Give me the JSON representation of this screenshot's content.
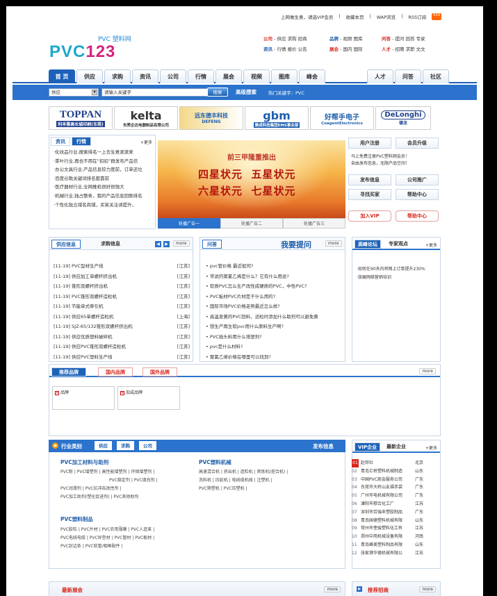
{
  "toplinks": [
    "上网做生意，请选VIP会员",
    "收藏本页",
    "WAP浏览",
    "RSS订阅"
  ],
  "logo": {
    "sub": "PVC 塑料网",
    "main1": "PVC",
    "main2": "123"
  },
  "chan1": {
    "r1": [
      "公司",
      "供应",
      "求购",
      "招商"
    ],
    "r2": [
      "资讯",
      "行情",
      "报价",
      "公告"
    ]
  },
  "chan2": {
    "r1": [
      "品牌",
      "视频",
      "图库"
    ],
    "r2": [
      "展会",
      "国内",
      "国际"
    ]
  },
  "chan3": {
    "r1": [
      "问答",
      "提问",
      "回答",
      "专家"
    ],
    "r2": [
      "人才",
      "招聘",
      "求职",
      "文文"
    ]
  },
  "tabs": [
    "首 页",
    "供应",
    "求购",
    "资讯",
    "公司",
    "行情",
    "展会",
    "视频",
    "图库",
    "峰会",
    "人才",
    "问答",
    "社区"
  ],
  "search": {
    "select": "供应",
    "input": "请输入关键字",
    "btn": "搜索",
    "adv": "高级搜索",
    "hot": "热门关键字：PVC"
  },
  "brands": [
    "TOPPAN",
    "kelta",
    "远东德丰科技",
    "gbm",
    "好帮手电子",
    "DeLonghi"
  ],
  "brand_subs": [
    "利丰雅高长城印刷(东莞)",
    "东莞企达电器制品有限公司",
    "DEFENG",
    "雅成科技集团EMS事业部",
    "CoagentElectronics",
    "德龙"
  ],
  "news_tabs": [
    "资讯",
    "行情"
  ],
  "more": "更多",
  "news": [
    "·化纹品行业,搜索排名一上去生意滚滚来",
    "·茶叶行业,再也不用在“扣扣”群发布产品信",
    "·办公文具行业,产品信息较力度前，订单还垃",
    "·百度谷歌关键词排名都靠前",
    "·医疗器材行业,全网推机很好很强大",
    "·机械行业,独占整条，我的产品信息回歌排名",
    "·个性化独立域名商铺，买家关注诱提升。"
  ],
  "banner": {
    "title": "前三甲隆重推出",
    "l1": [
      "四星状元",
      "五星状元"
    ],
    "l2": [
      "六星状元",
      "七星状元"
    ],
    "tabs": [
      "轮播广告一",
      "轮播广告二",
      "轮播广告三"
    ]
  },
  "right_btns": [
    "用户注册",
    "会员升级",
    "发布信息",
    "公司推广",
    "寻找买家",
    "帮助中心",
    "加入VIP",
    "帮助中心"
  ],
  "right_notes": [
    "马上免费注册PVC塑料网会员！",
    "自由发布信息，无限产品空间！"
  ],
  "supply_tabs": [
    "供应信息",
    "求购信息"
  ],
  "supply": [
    [
      "[11-19]",
      "PVC型材生产线",
      "[江苏]"
    ],
    [
      "[11-19]",
      "供应加工单螺杆挤出机",
      "[江苏]"
    ],
    [
      "[11-19]",
      "锥形双螺杆挤出机",
      "[江苏]"
    ],
    [
      "[11-19]",
      "PVC锥形双螺杆造粒机",
      "[江苏]"
    ],
    [
      "[11-19]",
      "节能单式牵引机",
      "[江苏]"
    ],
    [
      "[11-19]",
      "供应65单螺杆造粒机",
      "[上海]"
    ],
    [
      "[11-19]",
      "SJZ-65/132锥形双螺杆挤出机",
      "[江苏]"
    ],
    [
      "[11-19]",
      "供应优质塑料破碎机",
      "[江苏]"
    ],
    [
      "[11-19]",
      "供应PVC锥形双螺杆造粒机",
      "[江苏]"
    ],
    [
      "[11-19]",
      "供应PVC塑料生产线",
      "[江苏]"
    ]
  ],
  "qa": {
    "tab": "问答",
    "title": "我要提问",
    "more": "more",
    "items": [
      "pvc管价格 最近如何?",
      "常说的聚氯乙烯是什么？它有什么用途?",
      "软质PVC怎么生产改性成硬质的PVC，中性PVC?",
      "PVC板材PVC片材是干什么用的?",
      "国际市场PVC价格走势最近怎么样?",
      "高温发黄的PVC回料，适粒时添加什么助剂可以避免黄",
      "想生产再生软pvc用什么原料生产啊?",
      "PVC插头料用什么增塑剂?",
      "pvc是什么材料?",
      "聚氯乙烯价格在哪里可以找到?"
    ]
  },
  "forum": {
    "tabs": [
      "高峰论坛",
      "专家观点"
    ],
    "more": "更多",
    "items": [
      "·如何在90天内将网上订单提升230%",
      "·旅展网络营销培训"
    ]
  },
  "brandsec": {
    "tabs": [
      "推荐品牌",
      "国内品牌",
      "国外品牌"
    ],
    "more": "more",
    "b1": "品牌",
    "b2": "加成品牌"
  },
  "cat": {
    "label": "行业类别",
    "tabs": [
      "供应",
      "求购",
      "公司"
    ],
    "pub": "发布信息"
  },
  "cat1": {
    "title": "PVC加工材料与助剂",
    "lines": [
      "PVC粉 | PVC增塑剂 | 高性能增塑剂 | 环保增塑剂 |",
      "PVC稳定剂 | PVC填充剂 |",
      "PVC润滑剂 | PVC抗冲击改性剂 |",
      "PVC加工助剂(塑化促进剂) | PVC其他助剂"
    ]
  },
  "cat2": {
    "title": "PVC塑料机械",
    "lines": [
      "高速混合机 | 挤出机 | 造粒机 | 密炼机(捏合机) |",
      "洗料机 | 压延机 | 电线缆机械 | 注塑机 |",
      "PVC筛塑机 | PVC压塑机 |"
    ]
  },
  "cat3": {
    "title": "PVC塑料制品",
    "lines": [
      "PVC胶粒 | PVC片材 | PVC农用薄膜 | PVC人造革 |",
      "PVC电线电缆 | PVC异型材 | PVC管材 | PVC板材 |",
      "PVC封边条 | PVC软管/相框配件 |"
    ]
  },
  "vip": {
    "tabs": [
      "VIP企业",
      "最新企业"
    ],
    "more": "更多",
    "items": [
      [
        "01",
        "赵邦社",
        "北京"
      ],
      [
        "02",
        "青岛汇桥塑料机械制造",
        "山东"
      ],
      [
        "03",
        "中国PVC商会服务公司",
        "广东"
      ],
      [
        "04",
        "东莞市大岭山友福手袋",
        "广东"
      ],
      [
        "05",
        "广州市电机械有限公司",
        "广东"
      ],
      [
        "06",
        "溧阳市穆合化工厂",
        "江苏"
      ],
      [
        "07",
        "深圳市劳瑞丰塑胶制品",
        "广东"
      ],
      [
        "08",
        "青岛国德塑料机械有限",
        "山东"
      ],
      [
        "09",
        "常州市奎骏塑料化工有",
        "江苏"
      ],
      [
        "10",
        "郑州中用机械设备有限",
        "河南"
      ],
      [
        "11",
        "青岛峰美塑料制品有限",
        "山东"
      ],
      [
        "12",
        "张家港华德机械有限公",
        "江苏"
      ]
    ]
  },
  "bottom": {
    "expo": "最新展会",
    "more": "more",
    "recruit": "推荐招商"
  },
  "colors": {
    "blue": "#2b73cc",
    "red": "#d9261c",
    "logoCyan": "#1ea8c8",
    "logoPink": "#d6247d"
  }
}
